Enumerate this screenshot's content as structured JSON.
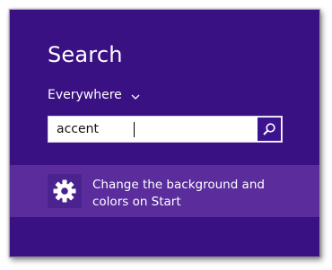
{
  "search_pane": {
    "title": "Search",
    "scope": {
      "label": "Everywhere",
      "icon": "chevron-down-icon"
    },
    "input": {
      "value": "accent",
      "icon": "search-icon"
    },
    "results": [
      {
        "icon": "gear-icon",
        "line1": "Change the background and",
        "line2": "colors on Start"
      }
    ]
  },
  "colors": {
    "pane_background": "#3a1183",
    "result_highlight": "#5a2c9c",
    "search_button": "#3b138f"
  }
}
